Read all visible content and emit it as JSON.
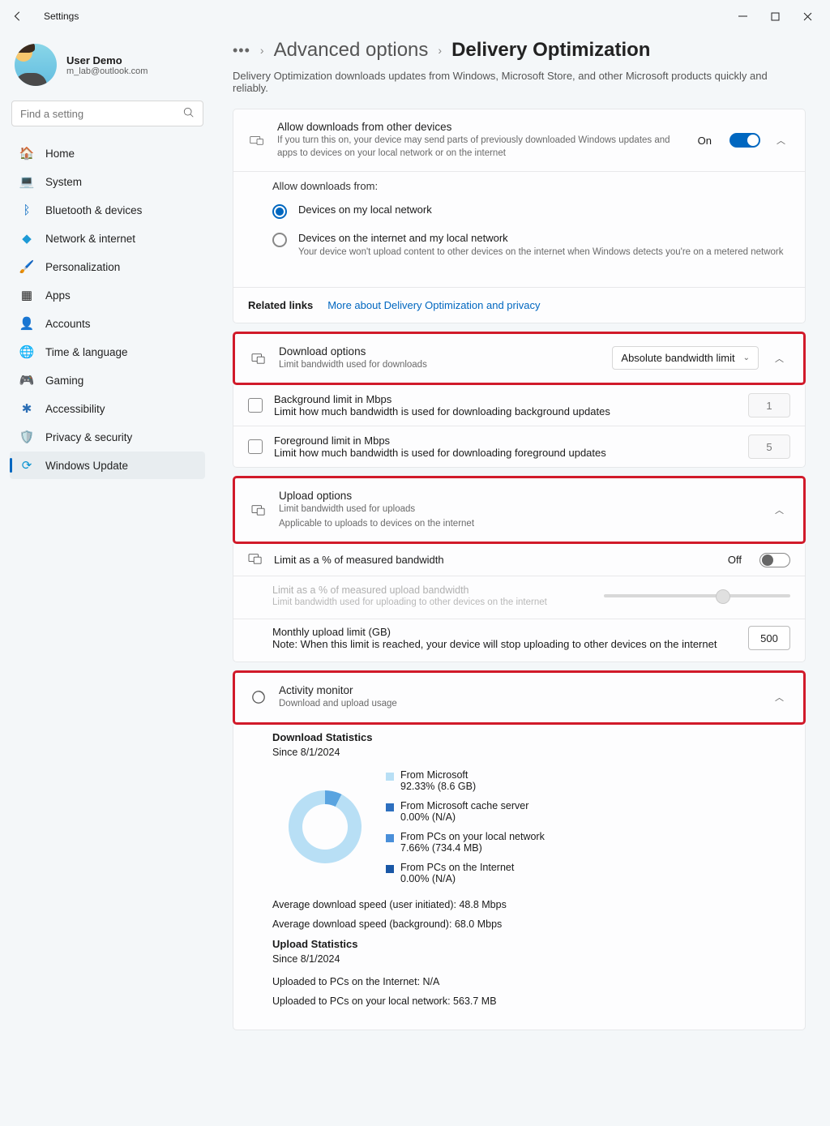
{
  "window": {
    "title": "Settings"
  },
  "profile": {
    "name": "User Demo",
    "email": "m_lab@outlook.com"
  },
  "search": {
    "placeholder": "Find a setting"
  },
  "nav": {
    "items": [
      {
        "label": "Home"
      },
      {
        "label": "System"
      },
      {
        "label": "Bluetooth & devices"
      },
      {
        "label": "Network & internet"
      },
      {
        "label": "Personalization"
      },
      {
        "label": "Apps"
      },
      {
        "label": "Accounts"
      },
      {
        "label": "Time & language"
      },
      {
        "label": "Gaming"
      },
      {
        "label": "Accessibility"
      },
      {
        "label": "Privacy & security"
      },
      {
        "label": "Windows Update"
      }
    ]
  },
  "breadcrumb": {
    "mid": "Advanced options",
    "current": "Delivery Optimization"
  },
  "description": "Delivery Optimization downloads updates from Windows, Microsoft Store, and other Microsoft products quickly and reliably.",
  "allowDownloads": {
    "title": "Allow downloads from other devices",
    "sub": "If you turn this on, your device may send parts of previously downloaded Windows updates and apps to devices on your local network or on the internet",
    "state": "On",
    "sectionHead": "Allow downloads from:",
    "opt1": "Devices on my local network",
    "opt2": "Devices on the internet and my local network",
    "opt2sub": "Your device won't upload content to other devices on the internet when Windows detects you're on a metered network"
  },
  "related": {
    "label": "Related links",
    "link": "More about Delivery Optimization and privacy"
  },
  "download": {
    "title": "Download options",
    "sub": "Limit bandwidth used for downloads",
    "dropdown": "Absolute bandwidth limit",
    "bg": {
      "t": "Background limit in Mbps",
      "s": "Limit how much bandwidth is used for downloading background updates",
      "v": "1"
    },
    "fg": {
      "t": "Foreground limit in Mbps",
      "s": "Limit how much bandwidth is used for downloading foreground updates",
      "v": "5"
    }
  },
  "upload": {
    "title": "Upload options",
    "sub": "Limit bandwidth used for uploads",
    "sub2": "Applicable to uploads to devices on the internet",
    "percent": {
      "t": "Limit as a % of measured bandwidth",
      "state": "Off"
    },
    "slider": {
      "t": "Limit as a % of measured upload bandwidth",
      "s": "Limit bandwidth used for uploading to other devices on the internet"
    },
    "monthly": {
      "t": "Monthly upload limit (GB)",
      "s": "Note: When this limit is reached, your device will stop uploading to other devices on the internet",
      "v": "500"
    }
  },
  "activity": {
    "title": "Activity monitor",
    "sub": "Download and upload usage",
    "dlhead": "Download Statistics",
    "since": "Since 8/1/2024",
    "leg1": {
      "t": "From Microsoft",
      "v": "92.33%  (8.6 GB)"
    },
    "leg2": {
      "t": "From Microsoft cache server",
      "v": "0.00%  (N/A)"
    },
    "leg3": {
      "t": "From PCs on your local network",
      "v": "7.66%  (734.4 MB)"
    },
    "leg4": {
      "t": "From PCs on the Internet",
      "v": "0.00%  (N/A)"
    },
    "avg1": "Average download speed (user initiated):   48.8 Mbps",
    "avg2": "Average download speed (background):   68.0 Mbps",
    "ulhead": "Upload Statistics",
    "since2": "Since 8/1/2024",
    "ul1": "Uploaded to PCs on the Internet: N/A",
    "ul2": "Uploaded to PCs on your local network: 563.7 MB"
  }
}
